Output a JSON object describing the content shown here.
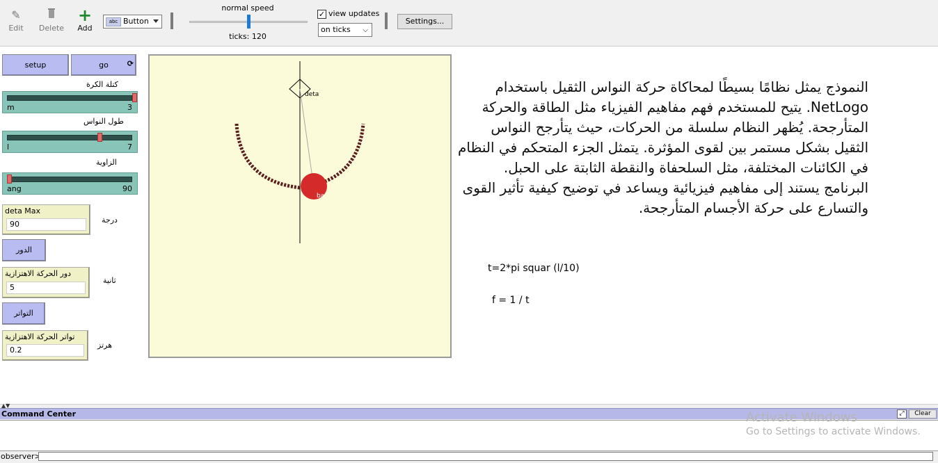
{
  "toolbar": {
    "edit_label": "Edit",
    "delete_label": "Delete",
    "add_label": "Add",
    "widget_type": "Button",
    "widget_chip": "abc",
    "speed_label": "normal speed",
    "speed_fraction": 0.5,
    "ticks_label": "ticks: 120",
    "view_updates_label": "view updates",
    "view_updates_checked": "✓",
    "update_mode": "on ticks",
    "settings_label": "Settings..."
  },
  "buttons": {
    "setup": "setup",
    "go": "go",
    "forever_icon": "⟳",
    "period": "الدور",
    "frequency": "التواتر"
  },
  "sliders": [
    {
      "title": "كتلة الكرة",
      "var": "m",
      "value": "3",
      "fraction": 1.0
    },
    {
      "title": "طول النواس",
      "var": "l",
      "value": "7",
      "fraction": 0.72
    },
    {
      "title": "الزاوية",
      "var": "ang",
      "value": "90",
      "fraction": 0.0
    }
  ],
  "monitors": [
    {
      "title": "deta Max",
      "value": "90",
      "unit": "درجة"
    },
    {
      "title": "دور الحركة الاهتزازية",
      "value": "5",
      "unit": "ثانية"
    },
    {
      "title": "تواتر الحركة الاهتزازية",
      "value": "0.2",
      "unit": "هرتز"
    }
  ],
  "world": {
    "pivot_label": "deta",
    "bob_label": "ba",
    "bob_color": "#d42a2a",
    "trail_color": "#5a1e1e"
  },
  "info": {
    "paragraph": "النموذج يمثل نظامًا بسيطًا لمحاكاة حركة النواس الثقيل باستخدام NetLogo. يتيح للمستخدم فهم مفاهيم الفيزياء مثل الطاقة والحركة المتأرجحة. يُظهر النظام سلسلة من الحركات، حيث يتأرجح النواس الثقيل بشكل مستمر بين لقوى المؤثرة. يتمثل الجزء المتحكم في النظام في الكائنات المختلفة، مثل السلحفاة والنقطة الثابتة على الحبل. البرنامج يستند إلى مفاهيم فيزيائية ويساعد في توضيح كيفية تأثير القوى والتسارع على حركة الأجسام المتأرجحة.",
    "formula_period": "t=2*pi squar (l/10)",
    "formula_frequency": "f = 1 / t"
  },
  "command_center": {
    "title": "Command Center",
    "clear_label": "Clear",
    "expand_icon": "⤢",
    "observer_label": "observer>",
    "input_value": ""
  },
  "watermark": {
    "line1": "Activate Windows",
    "line2": "Go to Settings to activate Windows."
  }
}
